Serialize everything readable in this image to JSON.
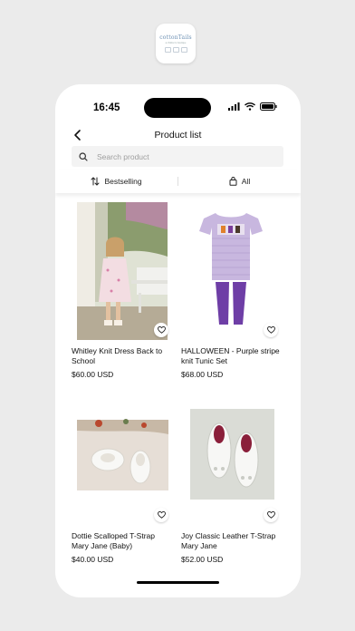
{
  "store": {
    "brand": "cottonTails",
    "tagline": "a children's boutique"
  },
  "status": {
    "time": "16:45"
  },
  "header": {
    "title": "Product list"
  },
  "search": {
    "placeholder": "Search product",
    "value": ""
  },
  "filters": {
    "sort_label": "Bestselling",
    "category_label": "All"
  },
  "products": [
    {
      "name": "Whitley Knit Dress Back to School",
      "price": "$60.00 USD"
    },
    {
      "name": "HALLOWEEN - Purple stripe knit Tunic Set",
      "price": "$68.00 USD"
    },
    {
      "name": "Dottie Scalloped T-Strap Mary Jane (Baby)",
      "price": "$40.00 USD"
    },
    {
      "name": "Joy Classic Leather T-Strap Mary Jane",
      "price": "$52.00 USD"
    }
  ],
  "icons": {
    "back": "chevron-left-icon",
    "search": "search-icon",
    "sort": "sort-arrows-icon",
    "category": "bag-icon",
    "favorite": "heart-icon"
  },
  "colors": {
    "background": "#ebebeb",
    "search_bg": "#f3f3f3",
    "text": "#111111",
    "placeholder": "#9e9e9e"
  }
}
